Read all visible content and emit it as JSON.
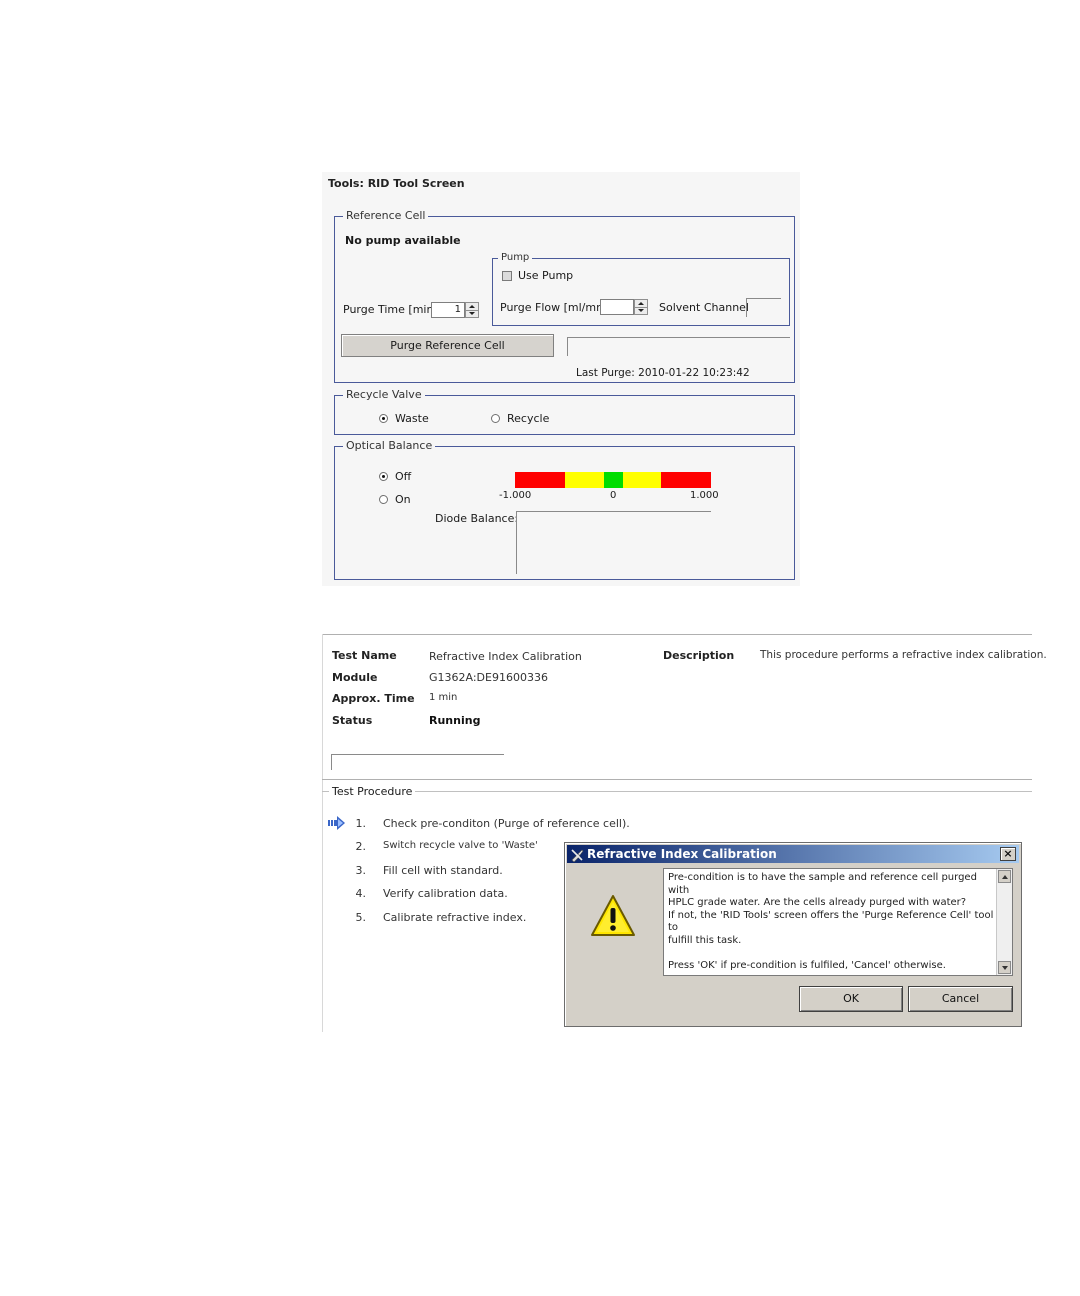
{
  "rid_tool": {
    "title": "Tools: RID Tool Screen",
    "reference_cell": {
      "legend": "Reference Cell",
      "no_pump_text": "No pump available",
      "purge_time_label": "Purge Time [min]",
      "purge_time_value": "1",
      "pump": {
        "legend": "Pump",
        "use_pump_label": "Use Pump",
        "use_pump_checked": false,
        "purge_flow_label": "Purge Flow [ml/mn]",
        "purge_flow_value": "",
        "solvent_channel_label": "Solvent Channel",
        "solvent_channel_value": ""
      },
      "purge_button_label": "Purge Reference Cell",
      "last_purge_text": "Last Purge: 2010-01-22 10:23:42"
    },
    "recycle_valve": {
      "legend": "Recycle Valve",
      "options": [
        {
          "label": "Waste",
          "selected": true
        },
        {
          "label": "Recycle",
          "selected": false
        }
      ]
    },
    "optical_balance": {
      "legend": "Optical Balance",
      "options": [
        {
          "label": "Off",
          "selected": true
        },
        {
          "label": "On",
          "selected": false
        }
      ],
      "balance_bar": {
        "scale_labels": [
          "-1.000",
          "0",
          "1.000"
        ],
        "colors": {
          "red": "#ff0000",
          "yellow": "#ffff00",
          "green": "#00dd00"
        }
      },
      "diode_balance_label": "Diode Balance:"
    }
  },
  "test": {
    "name_label": "Test Name",
    "name_value": "Refractive Index Calibration",
    "module_label": "Module",
    "module_value": "G1362A:DE91600336",
    "time_label": "Approx. Time",
    "time_value": "1 min",
    "status_label": "Status",
    "status_value": "Running",
    "description_label": "Description",
    "description_value": "This procedure performs a refractive index calibration.",
    "procedure": {
      "legend": "Test Procedure",
      "steps": [
        {
          "num": "1.",
          "text": "Check pre-conditon (Purge of reference cell)."
        },
        {
          "num": "2.",
          "text": "Switch recycle valve to 'Waste'"
        },
        {
          "num": "3.",
          "text": "Fill cell with standard."
        },
        {
          "num": "4.",
          "text": "Verify calibration data."
        },
        {
          "num": "5.",
          "text": "Calibrate refractive index."
        }
      ]
    }
  },
  "dialog": {
    "title": "Refractive Index Calibration",
    "close_glyph": "×",
    "message_lines": [
      "Pre-condition is to have the sample and reference cell purged with",
      "HPLC grade water. Are the cells already purged with water?",
      "If not, the 'RID Tools' screen offers the 'Purge Reference Cell' tool to",
      "fulfill this task.",
      "",
      "Press 'OK' if pre-condition is fulfiled, 'Cancel' otherwise."
    ],
    "ok_label": "OK",
    "cancel_label": "Cancel"
  }
}
